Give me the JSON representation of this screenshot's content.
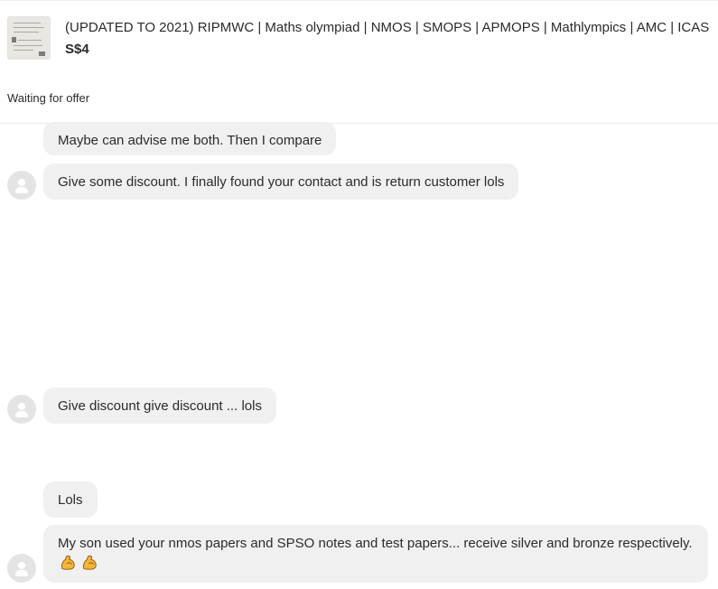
{
  "listing": {
    "title": "(UPDATED TO 2021) RIPMWC | Maths olympiad | NMOS | SMOPS | APMOPS | Mathlympics | AMC | ICAS",
    "price": "S$4",
    "thumbnail": "listing-photo-of-papers"
  },
  "offer_status": "Waiting for offer",
  "messages": [
    {
      "text": "Maybe can advise me both. Then I compare"
    },
    {
      "text": "Give some discount. I finally found your contact and is return customer lols"
    },
    {
      "text": "Give discount give discount ... lols"
    },
    {
      "text": "Lols"
    },
    {
      "text": "My son used your nmos papers and SPSO notes and test papers... receive silver and bronze respectively.",
      "emoji": "flexed-biceps-icon x2"
    }
  ],
  "colors": {
    "bubble": "#f0f0f0",
    "avatar": "#e4e4e4",
    "text": "#2b2b2b",
    "divider": "#ececec",
    "emoji": "#f2b53a"
  }
}
